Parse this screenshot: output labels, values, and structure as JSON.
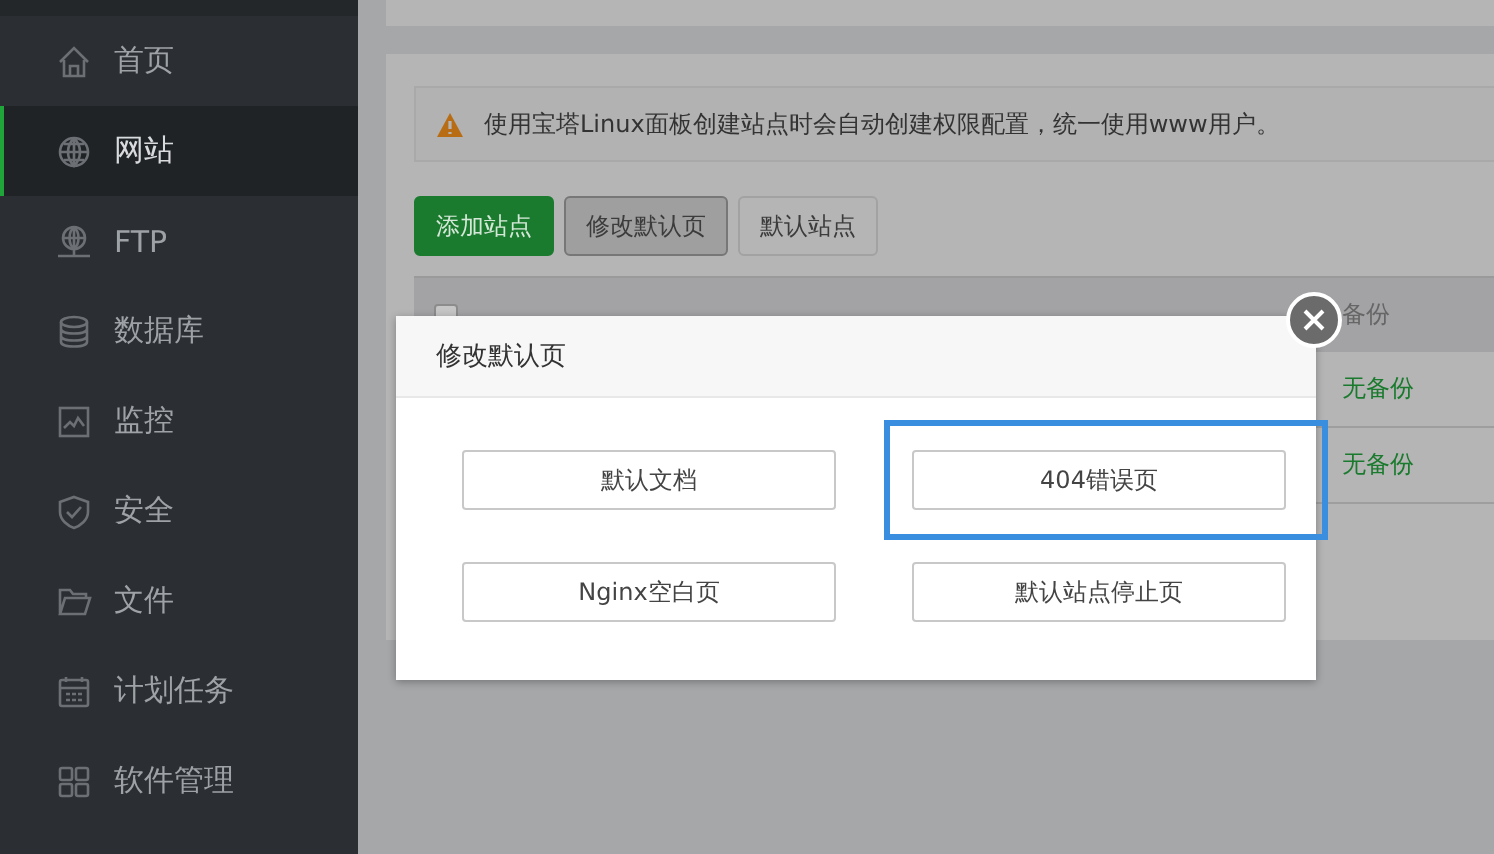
{
  "sidebar": {
    "items": [
      {
        "label": "首页",
        "selected": false
      },
      {
        "label": "网站",
        "selected": true
      },
      {
        "label": "FTP",
        "selected": false
      },
      {
        "label": "数据库",
        "selected": false
      },
      {
        "label": "监控",
        "selected": false
      },
      {
        "label": "安全",
        "selected": false
      },
      {
        "label": "文件",
        "selected": false
      },
      {
        "label": "计划任务",
        "selected": false
      },
      {
        "label": "软件管理",
        "selected": false
      }
    ]
  },
  "notice": {
    "text": "使用宝塔Linux面板创建站点时会自动创建权限配置，统一使用www用户。"
  },
  "toolbar": [
    {
      "label": "添加站点",
      "kind": "primary",
      "selected": false
    },
    {
      "label": "修改默认页",
      "kind": "default",
      "selected": true
    },
    {
      "label": "默认站点",
      "kind": "default",
      "selected": false
    }
  ],
  "table": {
    "select_all": {
      "checked": false
    },
    "columns": [
      "备份"
    ],
    "rows": [
      {
        "backup": "无备份"
      },
      {
        "backup": "无备份"
      }
    ]
  },
  "modal": {
    "title": "修改默认页",
    "options": [
      {
        "label": "默认文档",
        "selected": false
      },
      {
        "label": "404错误页",
        "selected": true
      },
      {
        "label": "Nginx空白页",
        "selected": false
      },
      {
        "label": "默认站点停止页",
        "selected": false
      }
    ]
  }
}
